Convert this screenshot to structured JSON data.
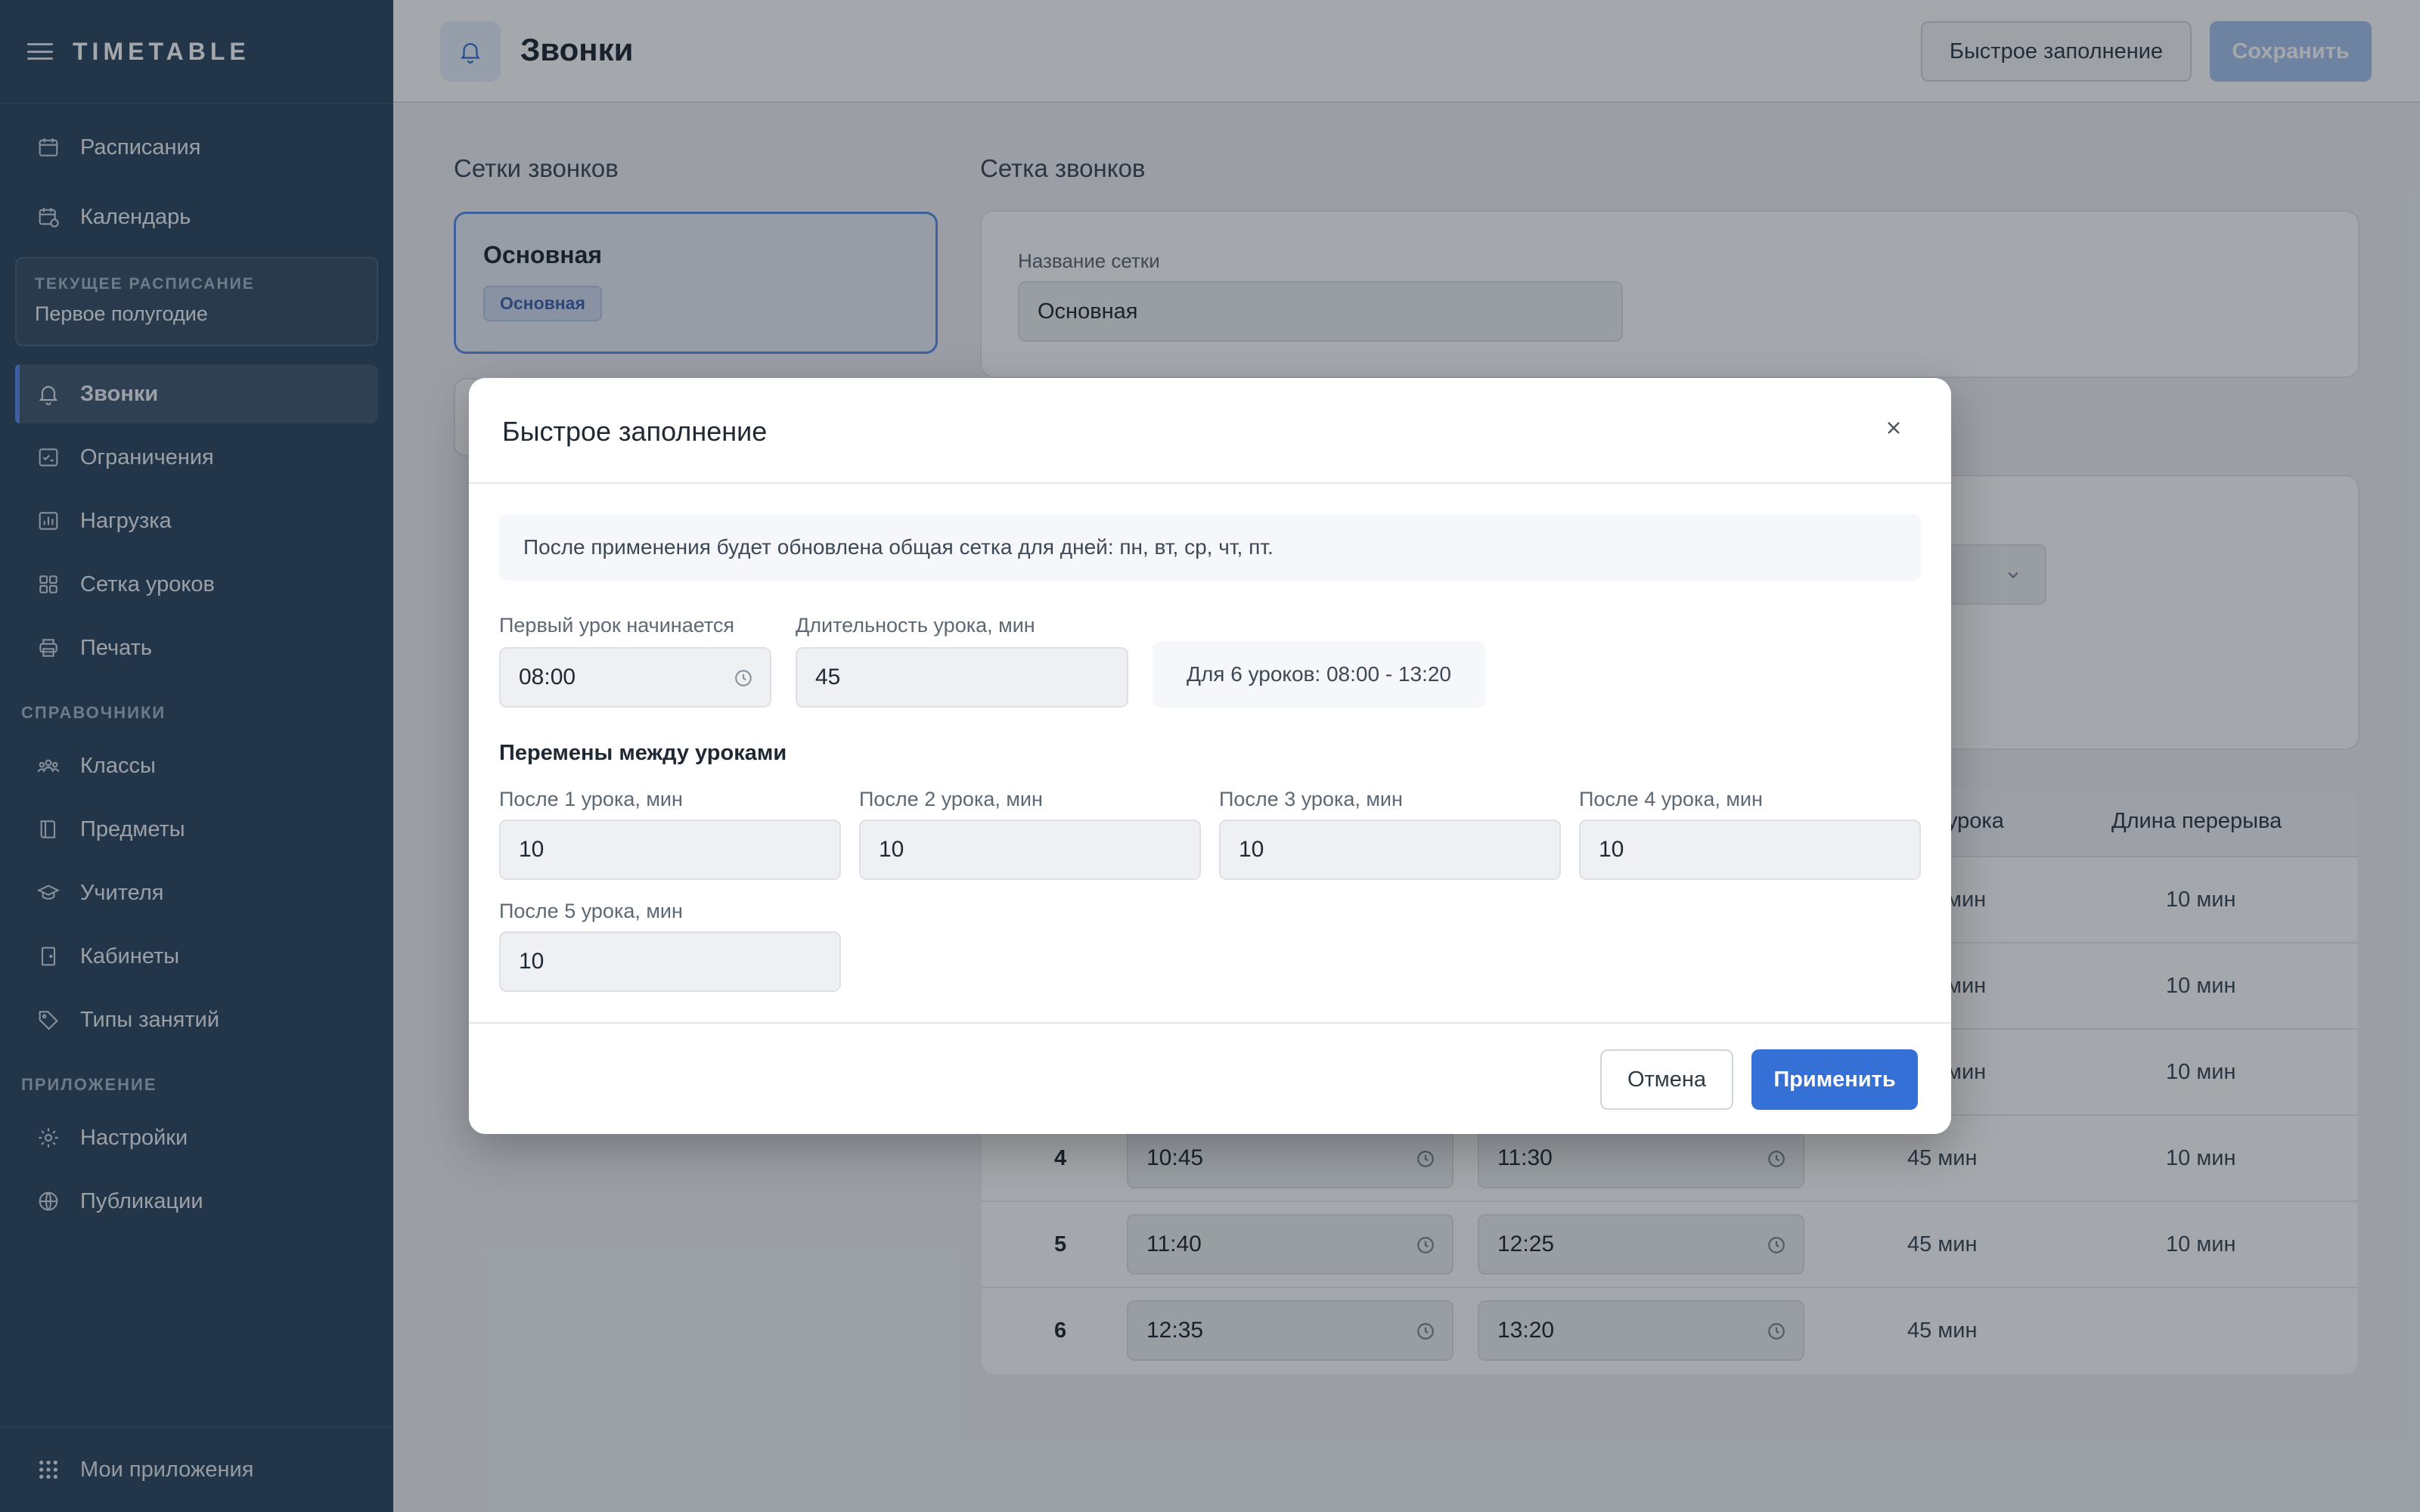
{
  "sidebar": {
    "brand": "TIMETABLE",
    "items_top": [
      {
        "label": "Расписания",
        "icon": "calendar-icon"
      },
      {
        "label": "Календарь",
        "icon": "calendar-clock-icon"
      }
    ],
    "current_schedule": {
      "caption": "ТЕКУЩЕЕ РАСПИСАНИЕ",
      "value": "Первое полугодие"
    },
    "items_main": [
      {
        "label": "Звонки",
        "icon": "bell-icon",
        "active": true
      },
      {
        "label": "Ограничения",
        "icon": "checklist-icon"
      },
      {
        "label": "Нагрузка",
        "icon": "bar-chart-icon"
      },
      {
        "label": "Сетка уроков",
        "icon": "grid-icon"
      },
      {
        "label": "Печать",
        "icon": "printer-icon"
      }
    ],
    "section_refs": "СПРАВОЧНИКИ",
    "items_refs": [
      {
        "label": "Классы",
        "icon": "users-icon"
      },
      {
        "label": "Предметы",
        "icon": "book-icon"
      },
      {
        "label": "Учителя",
        "icon": "graduation-cap-icon"
      },
      {
        "label": "Кабинеты",
        "icon": "door-icon"
      },
      {
        "label": "Типы занятий",
        "icon": "tag-icon"
      }
    ],
    "section_app": "ПРИЛОЖЕНИЕ",
    "items_app": [
      {
        "label": "Настройки",
        "icon": "gear-icon"
      },
      {
        "label": "Публикации",
        "icon": "globe-icon"
      }
    ],
    "footer": {
      "label": "Мои приложения",
      "icon": "apps-grid-icon"
    }
  },
  "topbar": {
    "title": "Звонки",
    "quick_fill_label": "Быстрое заполнение",
    "save_label": "Сохранить"
  },
  "main": {
    "grids_heading": "Сетки звонков",
    "grid_card": {
      "name": "Основная",
      "badge": "Основная"
    },
    "grid_heading": "Сетка звонков",
    "grid_name_label": "Название сетки",
    "grid_name_value": "Основная",
    "table": {
      "headers": [
        "урока",
        "Длина перерыва"
      ],
      "rows": [
        {
          "num": "4",
          "start": "10:45",
          "end": "11:30",
          "duration": "45 мин",
          "break": "10 мин"
        },
        {
          "num": "5",
          "start": "11:40",
          "end": "12:25",
          "duration": "45 мин",
          "break": "10 мин"
        },
        {
          "num": "6",
          "start": "12:35",
          "end": "13:20",
          "duration": "45 мин",
          "break": ""
        }
      ],
      "partial_rows": [
        {
          "duration": "мин",
          "break": "10 мин"
        },
        {
          "duration": "мин",
          "break": "10 мин"
        },
        {
          "duration": "мин",
          "break": "10 мин"
        }
      ]
    }
  },
  "modal": {
    "title": "Быстрое заполнение",
    "notice": "После применения будет обновлена общая сетка для дней: пн, вт, ср, чт, пт.",
    "first_lesson_label": "Первый урок начинается",
    "first_lesson_value": "08:00",
    "duration_label": "Длительность урока, мин",
    "duration_value": "45",
    "summary": "Для 6 уроков: 08:00 - 13:20",
    "breaks_heading": "Перемены между уроками",
    "breaks": [
      {
        "label": "После 1 урока, мин",
        "value": "10"
      },
      {
        "label": "После 2 урока, мин",
        "value": "10"
      },
      {
        "label": "После 3 урока, мин",
        "value": "10"
      },
      {
        "label": "После 4 урока, мин",
        "value": "10"
      },
      {
        "label": "После 5 урока, мин",
        "value": "10"
      }
    ],
    "cancel_label": "Отмена",
    "apply_label": "Применить"
  },
  "colors": {
    "sidebar_bg": "#2f4760",
    "accent": "#3470d6",
    "save_disabled": "#a9c4ef"
  }
}
